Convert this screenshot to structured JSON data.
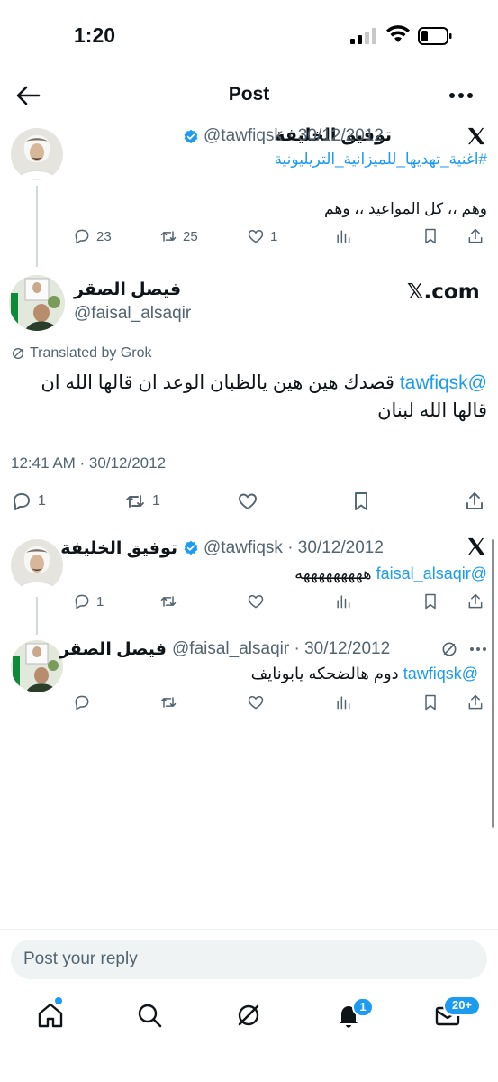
{
  "status_bar": {
    "time": "1:20"
  },
  "nav": {
    "title": "Post"
  },
  "parent_tweet": {
    "name": "توفيق الخليفة",
    "handle": "@tawfiqsk",
    "date": "· 30/12/2012",
    "hashtag": "#اغنية_تهديها_للميزانية_التريليونية",
    "text": "وهم ،، كل المواعيد ،، وهم",
    "replies": "23",
    "retweets": "25",
    "likes": "1"
  },
  "main_tweet": {
    "name": "فيصل الصقر",
    "handle": "@faisal_alsaqir",
    "source_badge": "𝕏.com",
    "translated_label": "Translated by Grok",
    "mention": "@tawfiqsk",
    "text": "قصدك هين هين يالظبان الوعد ان قالها الله ان قالها الله لبنان",
    "timestamp": "12:41 AM · 30/12/2012",
    "replies": "1",
    "retweets": "1"
  },
  "reply_1": {
    "name": "توفيق الخليفة",
    "handle": "@tawfiqsk",
    "date": "· 30/12/2012",
    "mention": "@faisal_alsaqir",
    "text": "هههههههههه",
    "replies": "1"
  },
  "reply_2": {
    "name": "فيصل الصقر",
    "handle": "@faisal_alsaqir",
    "date": "· 30/12/2012",
    "mention": "@tawfiqsk",
    "text": "دوم هالضحكه يابونايف"
  },
  "composer": {
    "placeholder": "Post your reply"
  },
  "tab_bar": {
    "notifications_badge": "1",
    "messages_badge": "20+"
  },
  "colors": {
    "accent": "#1d9bf0",
    "muted": "#536471",
    "text": "#0f1419"
  }
}
